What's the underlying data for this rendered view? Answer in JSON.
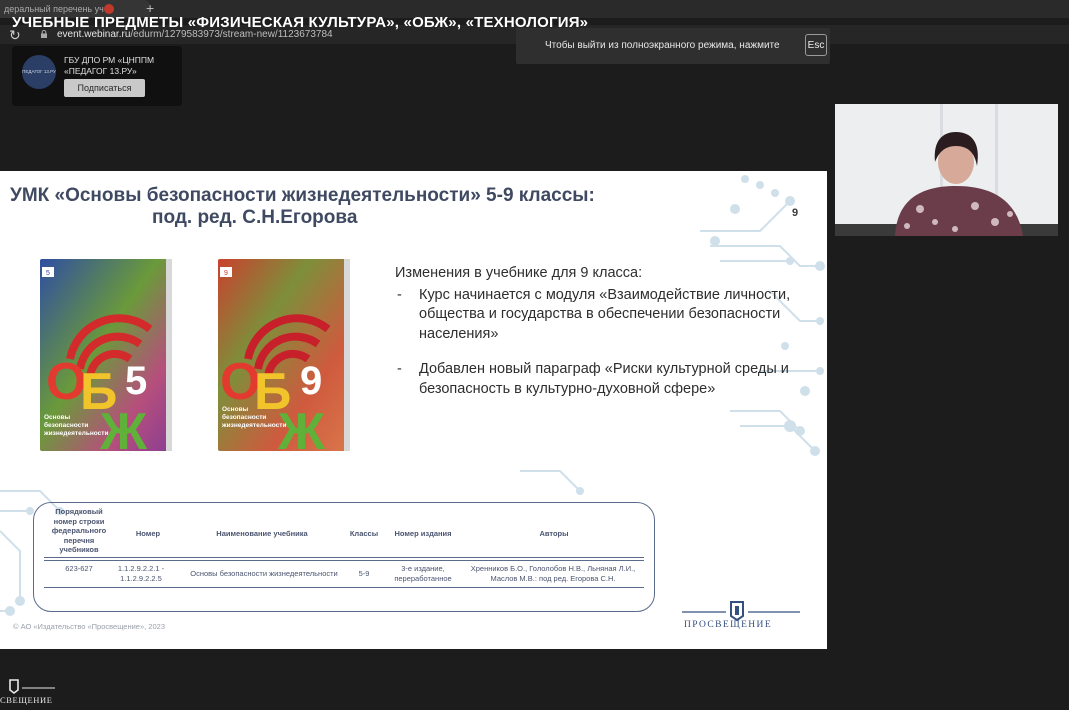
{
  "browser": {
    "tab_title": "деральный перечень уч",
    "tab_add_symbol": "+",
    "page_title": "УЧЕБНЫЕ ПРЕДМЕТЫ «ФИЗИЧЕСКАЯ КУЛЬТУРА», «ОБЖ», «ТЕХНОЛОГИЯ»",
    "url_host": "event.webinar.ru",
    "url_path": "/edurm/1279583973/stream-new/1123673784",
    "fullscreen_notice": "Чтобы выйти из полноэкранного режима, нажмите",
    "fullscreen_key": "Esc"
  },
  "organizer": {
    "avatar_label": "ПЕДАГОГ 13.РУ",
    "name": "ГБУ ДПО РМ «ЦНППМ «ПЕДАГОГ 13.РУ»",
    "subscribe_label": "Подписаться"
  },
  "slide": {
    "title_line1": "УМК «Основы безопасности жизнедеятельности» 5-9 классы:",
    "title_line2": "под. ред. С.Н.Егорова",
    "number": "9",
    "changes_heading": "Изменения в учебнике для 9 класса:",
    "bullets": [
      "Курс начинается с модуля «Взаимодействие личности, общества и государства в обеспечении безопасности населения»",
      "Добавлен новый параграф «Риски культурной среды и безопасность в культурно-духовной сфере»"
    ],
    "bullet_dash": "-",
    "book5": {
      "letters": [
        "О",
        "Б",
        "Ж"
      ],
      "grade": "5",
      "subtitle": [
        "Основы",
        "безопасности",
        "жизнедеятельности"
      ],
      "colors": {
        "top": "#2f4ea2",
        "bottom": "#8a3d93",
        "mid": "#6a9a3a"
      }
    },
    "book9": {
      "letters": [
        "О",
        "Б",
        "Ж"
      ],
      "grade": "9",
      "subtitle": [
        "Основы",
        "безопасности",
        "жизнедеятельности"
      ],
      "colors": {
        "top": "#c9412f",
        "bottom": "#d9774b",
        "mid": "#7d8f3a"
      }
    },
    "table": {
      "headers": [
        "Порядковый номер строки федерального перечня учебников",
        "Номер",
        "Наименование учебника",
        "Классы",
        "Номер издания",
        "Авторы"
      ],
      "row": [
        "623-627",
        "1.1.2.9.2.2.1 - 1.1.2.9.2.2.5",
        "Основы безопасности жизнедеятельности",
        "5-9",
        "3-е издание, переработанное",
        "Хренников Б.О., Гололобов Н.В., Льняная Л.И., Маслов М.В.: под ред. Егорова С.Н."
      ]
    },
    "copyright": "© АО «Издательство «Просвещение», 2023",
    "publisher": "ПРОСВЕЩЕНИЕ"
  },
  "corner_logo": "СВЕЩЕНИЕ",
  "colors": {
    "slide_title": "#3f4a62",
    "circuit": "#c6dbe6",
    "publisher": "#35507e"
  }
}
